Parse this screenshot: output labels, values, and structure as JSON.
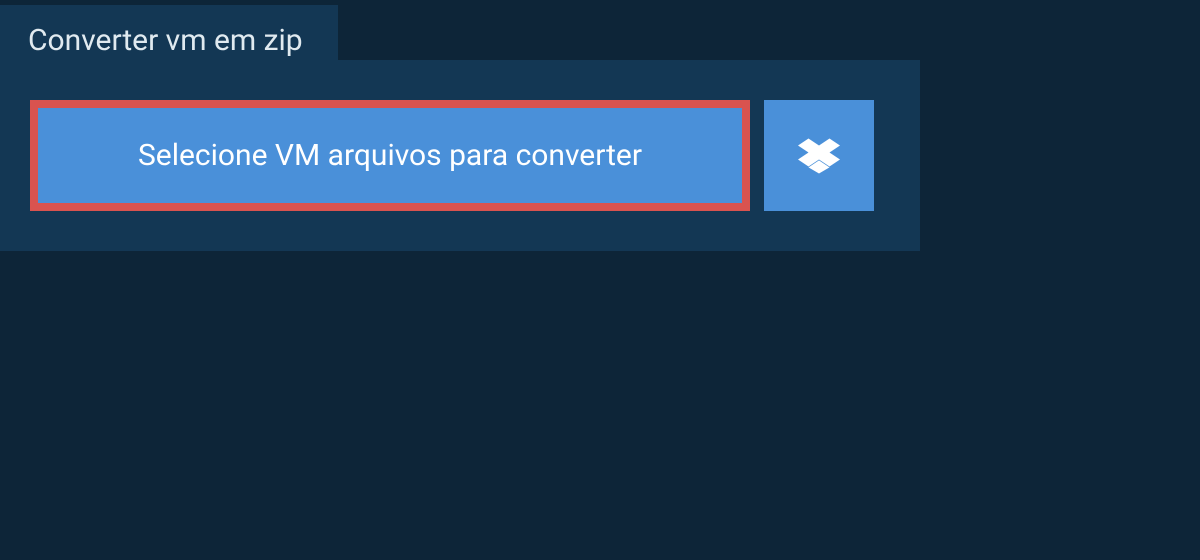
{
  "tab": {
    "title": "Converter vm em zip"
  },
  "actions": {
    "select_label": "Selecione VM arquivos para converter"
  },
  "colors": {
    "background": "#0d2538",
    "card": "#133754",
    "primary": "#4a90d9",
    "highlight_border": "#d9534f"
  }
}
